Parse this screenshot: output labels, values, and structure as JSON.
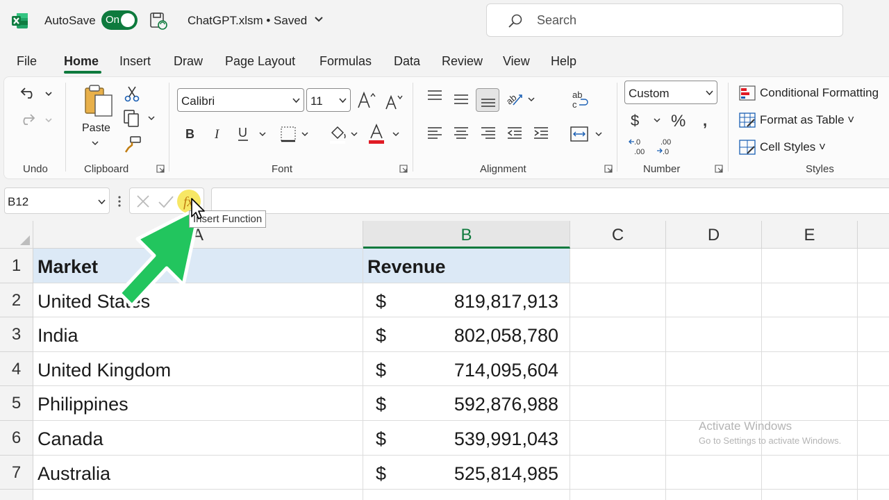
{
  "titlebar": {
    "autosave_label": "AutoSave",
    "autosave_state": "On",
    "file_title": "ChatGPT.xlsm • Saved",
    "search_placeholder": "Search"
  },
  "tabs": [
    "File",
    "Home",
    "Insert",
    "Draw",
    "Page Layout",
    "Formulas",
    "Data",
    "Review",
    "View",
    "Help"
  ],
  "active_tab": "Home",
  "ribbon": {
    "groups": {
      "undo": "Undo",
      "clipboard": "Clipboard",
      "font": "Font",
      "alignment": "Alignment",
      "number": "Number",
      "styles": "Styles"
    },
    "paste_label": "Paste",
    "font_name": "Calibri",
    "font_size": "11",
    "number_format": "Custom",
    "styles": {
      "conditional_formatting": "Conditional Formatting",
      "format_as_table": "Format as Table",
      "cell_styles": "Cell Styles"
    }
  },
  "formula_bar": {
    "name_box": "B12",
    "formula": "",
    "tooltip": "Insert Function"
  },
  "grid": {
    "columns": [
      "A",
      "B",
      "C",
      "D",
      "E"
    ],
    "selected_column": "B",
    "row_numbers": [
      "1",
      "2",
      "3",
      "4",
      "5",
      "6",
      "7"
    ],
    "header": {
      "market": "Market",
      "revenue": "Revenue"
    },
    "currency_symbol": "$",
    "rows": [
      {
        "market": "United States",
        "revenue": "819,817,913"
      },
      {
        "market": "India",
        "revenue": "802,058,780"
      },
      {
        "market": "United Kingdom",
        "revenue": "714,095,604"
      },
      {
        "market": "Philippines",
        "revenue": "592,876,988"
      },
      {
        "market": "Canada",
        "revenue": "539,991,043"
      },
      {
        "market": "Australia",
        "revenue": "525,814,985"
      }
    ]
  },
  "watermark": {
    "line1": "Activate Windows",
    "line2": "Go to Settings to activate Windows."
  },
  "colors": {
    "accent": "#0e7a3d",
    "header_fill": "#dce9f6",
    "annotation_arrow": "#22c55e"
  }
}
